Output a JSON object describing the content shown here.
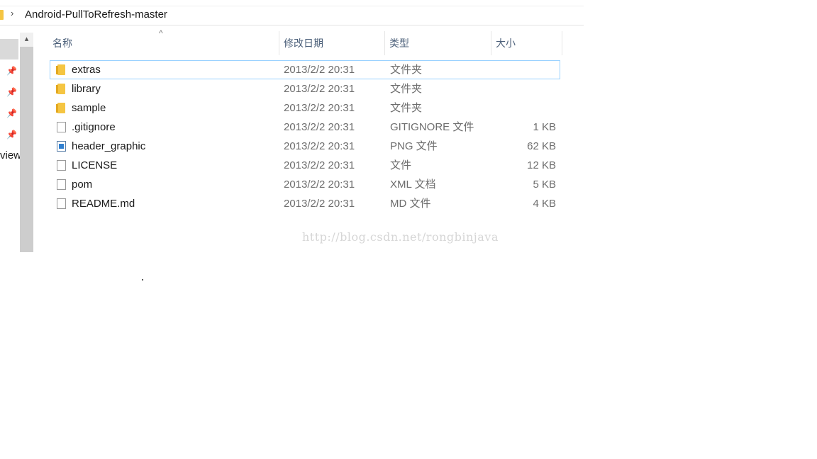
{
  "address_bar": {
    "chevron": "›",
    "path": "Android-PullToRefresh-master"
  },
  "nav_pane": {
    "pins": [
      "pin-icon",
      "pin-icon",
      "pin-icon",
      "pin-icon"
    ],
    "partial_label": "view"
  },
  "columns": {
    "name": "名称",
    "date_modified": "修改日期",
    "type": "类型",
    "size": "大小",
    "sort_indicator": "^"
  },
  "files": [
    {
      "name": "extras",
      "date": "2013/2/2 20:31",
      "type": "文件夹",
      "size": "",
      "icon": "folder-icon"
    },
    {
      "name": "library",
      "date": "2013/2/2 20:31",
      "type": "文件夹",
      "size": "",
      "icon": "folder-icon"
    },
    {
      "name": "sample",
      "date": "2013/2/2 20:31",
      "type": "文件夹",
      "size": "",
      "icon": "folder-icon"
    },
    {
      "name": ".gitignore",
      "date": "2013/2/2 20:31",
      "type": "GITIGNORE 文件",
      "size": "1 KB",
      "icon": "file-icon"
    },
    {
      "name": "header_graphic",
      "date": "2013/2/2 20:31",
      "type": "PNG 文件",
      "size": "62 KB",
      "icon": "image-file-icon"
    },
    {
      "name": "LICENSE",
      "date": "2013/2/2 20:31",
      "type": "文件",
      "size": "12 KB",
      "icon": "file-icon"
    },
    {
      "name": "pom",
      "date": "2013/2/2 20:31",
      "type": "XML 文档",
      "size": "5 KB",
      "icon": "file-icon"
    },
    {
      "name": "README.md",
      "date": "2013/2/2 20:31",
      "type": "MD 文件",
      "size": "4 KB",
      "icon": "file-icon"
    }
  ],
  "watermark": "http://blog.csdn.net/rongbinjava",
  "colors": {
    "folder": "#f5c542",
    "focus_border": "#99d1ff",
    "header_text": "#4c607a",
    "secondary_text": "#6d6d6d"
  }
}
